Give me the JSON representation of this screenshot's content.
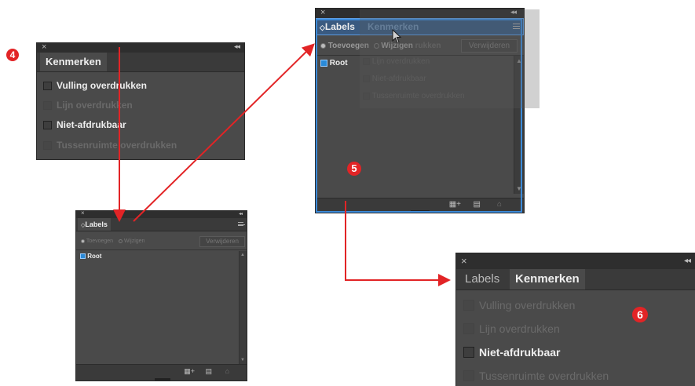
{
  "markers": {
    "m4": "4",
    "m5": "5",
    "m6": "6"
  },
  "close_glyph": "×",
  "collapse_glyph": "◂◂",
  "panel_kenmerken": {
    "tab": "Kenmerken",
    "options": [
      {
        "label": "Vulling overdrukken",
        "enabled": true
      },
      {
        "label": "Lijn overdrukken",
        "enabled": false
      },
      {
        "label": "Niet-afdrukbaar",
        "enabled": true
      },
      {
        "label": "Tussenruimte overdrukken",
        "enabled": false
      }
    ]
  },
  "panel_labels_small": {
    "tab": "Labels",
    "radio_add": "Toevoegen",
    "radio_edit": "Wijzigen",
    "remove_button": "Verwijderen",
    "root": "Root"
  },
  "panel_labels_drag": {
    "tab_labels": "Labels",
    "tab_kenmerken": "Kenmerken",
    "radio_add": "Toevoegen",
    "radio_edit": "Wijzigen",
    "ghost_suffix": "rukken",
    "remove_button": "Verwijderen",
    "root": "Root",
    "ghost_options": [
      "Lijn overdrukken",
      "Niet-afdrukbaar",
      "Tussenruimte overdrukken"
    ]
  },
  "panel_combined": {
    "tab_labels": "Labels",
    "tab_kenmerken": "Kenmerken",
    "options": [
      {
        "label": "Vulling overdrukken",
        "enabled": false
      },
      {
        "label": "Lijn overdrukken",
        "enabled": false
      },
      {
        "label": "Niet-afdrukbaar",
        "enabled": true
      },
      {
        "label": "Tussenruimte overdrukken",
        "enabled": false
      }
    ]
  },
  "colors": {
    "accent": "#e22426",
    "panel": "#4a4a4a",
    "highlight": "#3c8ad8"
  },
  "icons": [
    "close-icon",
    "collapse-icon",
    "panel-menu-icon",
    "new-label-icon",
    "page-icon",
    "trash-icon",
    "cursor-icon"
  ]
}
